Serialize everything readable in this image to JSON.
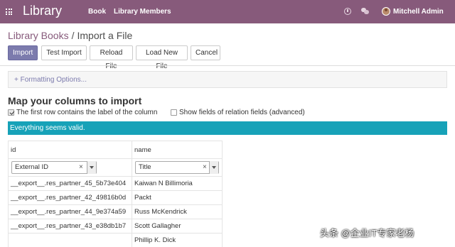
{
  "navbar": {
    "app_title": "Library",
    "menu": [
      "Book",
      "Library Members"
    ],
    "user_name": "Mitchell Admin",
    "accent_color": "#875a7b",
    "icons": [
      "apps-icon",
      "clock-icon",
      "chat-icon",
      "avatar"
    ]
  },
  "breadcrumb": {
    "parent": "Library Books",
    "separator": "/",
    "current": "Import a File"
  },
  "buttons": {
    "import": "Import",
    "test_import": "Test Import",
    "reload_file": "Reload File",
    "load_new_file": "Load New File",
    "cancel": "Cancel"
  },
  "formatting_options": "+ Formatting Options...",
  "mapping": {
    "heading": "Map your columns to import",
    "first_row_label": "The first row contains the label of the column",
    "first_row_checked": true,
    "relation_fields_label": "Show fields of relation fields (advanced)",
    "relation_fields_checked": false
  },
  "alert": {
    "text": "Everything seems valid.",
    "color": "#17a2b8"
  },
  "preview": {
    "columns": [
      "id",
      "name"
    ],
    "mapped_fields": [
      "External ID",
      "Title"
    ],
    "clear_symbol": "×",
    "rows": [
      [
        "__export__.res_partner_45_5b73e404",
        "Kaiwan N Billimoria"
      ],
      [
        "__export__.res_partner_42_49816b0d",
        "Packt"
      ],
      [
        "__export__.res_partner_44_9e374a59",
        "Russ McKendrick"
      ],
      [
        "__export__.res_partner_43_e38db1b7",
        "Scott Gallagher"
      ],
      [
        "",
        "Phillip K. Dick"
      ]
    ]
  },
  "watermark": "头条 @企业IT专家老杨"
}
